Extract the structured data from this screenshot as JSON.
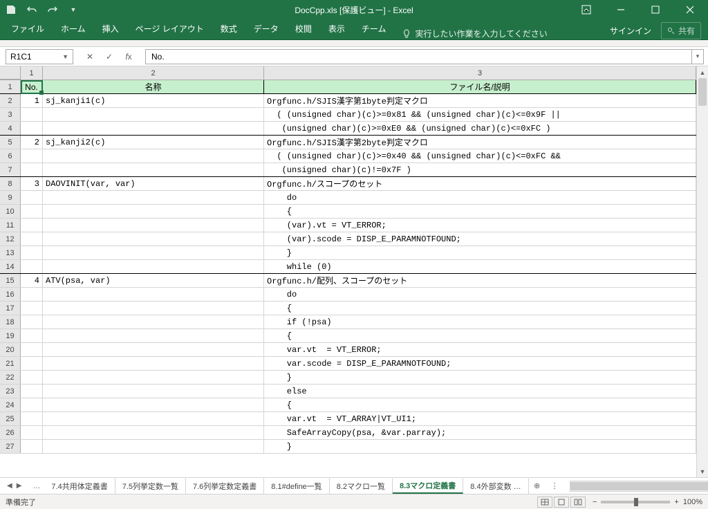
{
  "titlebar": {
    "title": "DocCpp.xls  [保護ビュー] - Excel"
  },
  "ribbon": {
    "tabs": [
      "ファイル",
      "ホーム",
      "挿入",
      "ページ レイアウト",
      "数式",
      "データ",
      "校閲",
      "表示",
      "チーム"
    ],
    "tell_me": "実行したい作業を入力してください",
    "signin": "サインイン",
    "share": "共有"
  },
  "formula_bar": {
    "name_box": "R1C1",
    "formula": "No."
  },
  "columns": [
    "1",
    "2",
    "3"
  ],
  "header_row": {
    "c1": "No.",
    "c2": "名称",
    "c3": "ファイル名/説明"
  },
  "rows": [
    {
      "n": "2",
      "c1": "1",
      "c2": "sj_kanji1(c)",
      "c3": "Orgfunc.h/SJIS漢字第1byte判定マクロ"
    },
    {
      "n": "3",
      "c1": "",
      "c2": "",
      "c3": "  ( (unsigned char)(c)>=0x81 && (unsigned char)(c)<=0x9F ||"
    },
    {
      "n": "4",
      "c1": "",
      "c2": "",
      "c3": "   (unsigned char)(c)>=0xE0 && (unsigned char)(c)<=0xFC )",
      "sb": true
    },
    {
      "n": "5",
      "c1": "2",
      "c2": "sj_kanji2(c)",
      "c3": "Orgfunc.h/SJIS漢字第2byte判定マクロ"
    },
    {
      "n": "6",
      "c1": "",
      "c2": "",
      "c3": "  ( (unsigned char)(c)>=0x40 && (unsigned char)(c)<=0xFC &&"
    },
    {
      "n": "7",
      "c1": "",
      "c2": "",
      "c3": "   (unsigned char)(c)!=0x7F )",
      "sb": true
    },
    {
      "n": "8",
      "c1": "3",
      "c2": "DAOVINIT(var, var)",
      "c3": "Orgfunc.h/スコープのセット"
    },
    {
      "n": "9",
      "c1": "",
      "c2": "",
      "c3": "    do"
    },
    {
      "n": "10",
      "c1": "",
      "c2": "",
      "c3": "    {"
    },
    {
      "n": "11",
      "c1": "",
      "c2": "",
      "c3": "    (var).vt = VT_ERROR;"
    },
    {
      "n": "12",
      "c1": "",
      "c2": "",
      "c3": "    (var).scode = DISP_E_PARAMNOTFOUND;"
    },
    {
      "n": "13",
      "c1": "",
      "c2": "",
      "c3": "    }"
    },
    {
      "n": "14",
      "c1": "",
      "c2": "",
      "c3": "    while (0)",
      "sb": true
    },
    {
      "n": "15",
      "c1": "4",
      "c2": "ATV(psa, var)",
      "c3": "Orgfunc.h/配列、スコープのセット"
    },
    {
      "n": "16",
      "c1": "",
      "c2": "",
      "c3": "    do"
    },
    {
      "n": "17",
      "c1": "",
      "c2": "",
      "c3": "    {"
    },
    {
      "n": "18",
      "c1": "",
      "c2": "",
      "c3": "    if (!psa)"
    },
    {
      "n": "19",
      "c1": "",
      "c2": "",
      "c3": "    {"
    },
    {
      "n": "20",
      "c1": "",
      "c2": "",
      "c3": "    var.vt  = VT_ERROR;"
    },
    {
      "n": "21",
      "c1": "",
      "c2": "",
      "c3": "    var.scode = DISP_E_PARAMNOTFOUND;"
    },
    {
      "n": "22",
      "c1": "",
      "c2": "",
      "c3": "    }"
    },
    {
      "n": "23",
      "c1": "",
      "c2": "",
      "c3": "    else"
    },
    {
      "n": "24",
      "c1": "",
      "c2": "",
      "c3": "    {"
    },
    {
      "n": "25",
      "c1": "",
      "c2": "",
      "c3": "    var.vt  = VT_ARRAY|VT_UI1;"
    },
    {
      "n": "26",
      "c1": "",
      "c2": "",
      "c3": "    SafeArrayCopy(psa, &var.parray);"
    },
    {
      "n": "27",
      "c1": "",
      "c2": "",
      "c3": "    }"
    }
  ],
  "sheet_tabs": {
    "ellipsis": "…",
    "tabs": [
      "7.4共用体定義書",
      "7.5列挙定数一覧",
      "7.6列挙定数定義書",
      "8.1#define一覧",
      "8.2マクロ一覧",
      "8.3マクロ定義書",
      "8.4外部変数 …"
    ],
    "active": 5
  },
  "status": {
    "ready": "準備完了",
    "zoom": "100%"
  }
}
